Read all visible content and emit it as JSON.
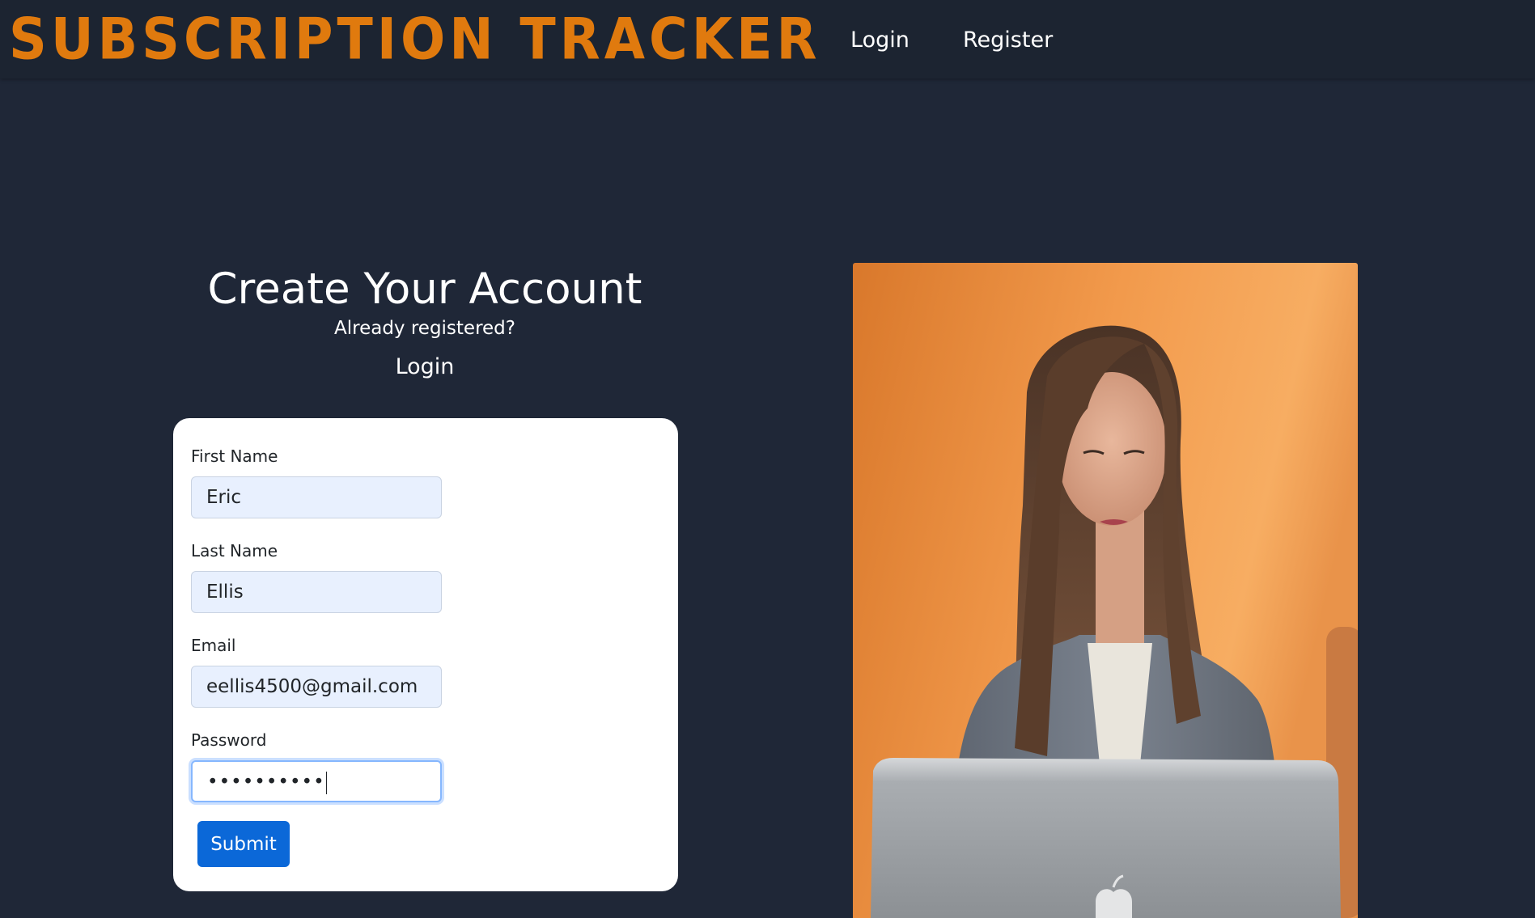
{
  "navbar": {
    "brand": "SUBSCRIPTION TRACKER",
    "links": [
      {
        "label": "Login"
      },
      {
        "label": "Register"
      }
    ]
  },
  "heading": {
    "title": "Create Your Account",
    "subtitle": "Already registered?",
    "login_link": "Login"
  },
  "form": {
    "first_name": {
      "label": "First Name",
      "value": "Eric"
    },
    "last_name": {
      "label": "Last Name",
      "value": "Ellis"
    },
    "email": {
      "label": "Email",
      "value": "eellis4500@gmail.com"
    },
    "password": {
      "label": "Password",
      "value": "••••••••••"
    },
    "submit_label": "Submit"
  },
  "colors": {
    "background": "#1f2737",
    "navbar": "#1c2431",
    "brand": "#e07a0e",
    "primary_button": "#0b68d8",
    "input_autofill": "#e8f0fe"
  }
}
